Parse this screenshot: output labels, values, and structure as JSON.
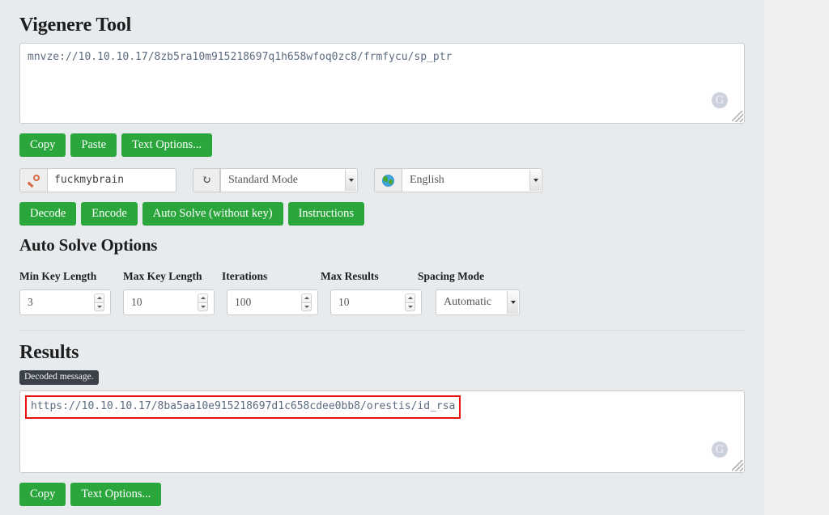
{
  "page": {
    "title": "Vigenere Tool",
    "autosolve_title": "Auto Solve Options",
    "results_title": "Results"
  },
  "input": {
    "text": "mnvze://10.10.10.17/8zb5ra10m915218697q1h658wfoq0zc8/frmfycu/sp_ptr",
    "watermark": "G"
  },
  "input_toolbar": {
    "copy": "Copy",
    "paste": "Paste",
    "text_options": "Text Options..."
  },
  "key_row": {
    "key_icon": "key-icon",
    "key_value": "fuckmybrain",
    "refresh_icon": "refresh-icon",
    "mode_value": "Standard Mode",
    "language_icon": "globe-icon",
    "language_value": "English"
  },
  "actions": {
    "decode": "Decode",
    "encode": "Encode",
    "auto_solve": "Auto Solve (without key)",
    "instructions": "Instructions"
  },
  "autosolve": {
    "fields": [
      {
        "label": "Min Key Length",
        "value": "3",
        "type": "number"
      },
      {
        "label": "Max Key Length",
        "value": "10",
        "type": "number"
      },
      {
        "label": "Iterations",
        "value": "100",
        "type": "number"
      },
      {
        "label": "Max Results",
        "value": "10",
        "type": "number"
      },
      {
        "label": "Spacing Mode",
        "value": "Automatic",
        "type": "select"
      }
    ]
  },
  "results": {
    "badge": "Decoded message.",
    "text": "https://10.10.10.17/8ba5aa10e915218697d1c658cdee0bb8/orestis/id_rsa",
    "watermark": "G",
    "highlight_color": "#e8110e"
  },
  "results_toolbar": {
    "copy": "Copy",
    "text_options": "Text Options..."
  },
  "colors": {
    "button_green": "#2aa63c",
    "page_background": "#e7ebee",
    "outer_background": "#f0f0f0",
    "badge_background": "#3b4149"
  }
}
